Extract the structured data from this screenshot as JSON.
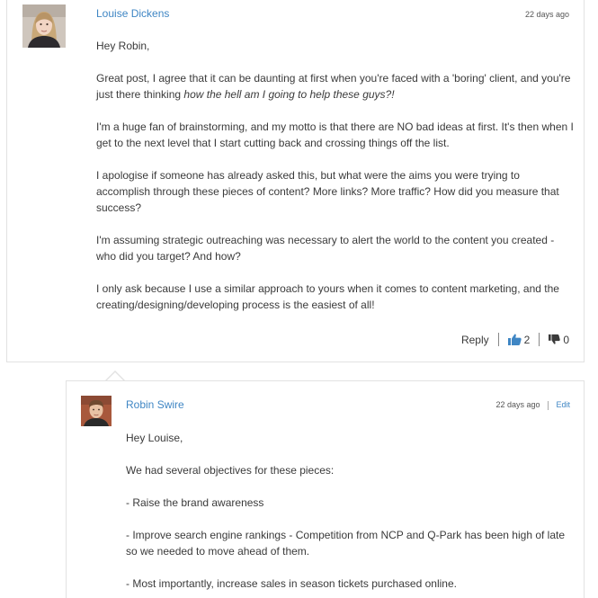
{
  "comments": [
    {
      "author": "Louise Dickens",
      "time": "22 days ago",
      "paragraphs": {
        "greeting": "Hey Robin,",
        "p1_text": "Great post, I agree that it can be daunting at first when you're faced with a 'boring' client, and you're just there thinking ",
        "p1_emphasis": "how the hell am I going to help these guys?!",
        "p2": "I'm a huge fan of brainstorming, and my motto is that there are NO bad ideas at first. It's then when I get to the next level that I start cutting back and crossing things off the list.",
        "p3": "I apologise if someone has already asked this, but what were the aims you were trying to accomplish through these pieces of content? More links? More traffic? How did you measure that success?",
        "p4": "I'm assuming strategic outreaching was necessary to alert the world to the content you created - who did you target? And how?",
        "p5": "I only ask because I use a similar approach to yours when it comes to content marketing, and the creating/designing/developing process is the easiest of all!"
      },
      "actions": {
        "reply_label": "Reply",
        "thumbs_up_count": "2",
        "thumbs_down_count": "0"
      }
    },
    {
      "author": "Robin Swire",
      "time": "22 days ago",
      "edit_label": "Edit",
      "paragraphs": {
        "greeting": "Hey Louise,",
        "p1": "We had several objectives for these pieces:",
        "p2": "- Raise the brand awareness",
        "p3": "- Improve search engine rankings - Competition from NCP and Q-Park has been high of late so we needed to move ahead of them.",
        "p4": "- Most importantly, increase sales in season tickets purchased online."
      }
    }
  ],
  "icons": {
    "thumbs_up": "thumbs-up-icon",
    "thumbs_down": "thumbs-down-icon"
  },
  "colors": {
    "link": "#3f86c4",
    "thumbs_up": "#3f86c4",
    "thumbs_down": "#3a3a3a",
    "border": "#e2e2e2"
  }
}
